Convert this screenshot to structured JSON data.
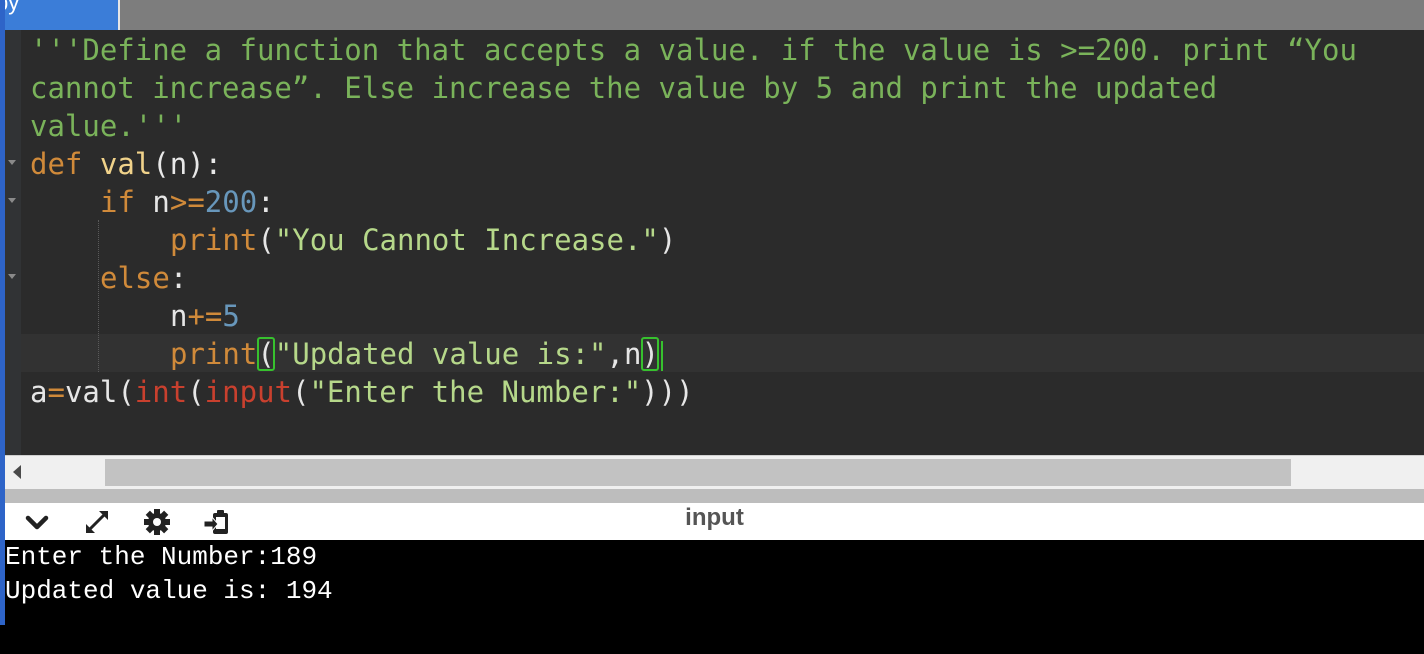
{
  "tab": {
    "label": "py"
  },
  "editor": {
    "docstring": [
      "'''Define a function that accepts a value. if the value is >=200. print “You",
      "cannot increase”. Else increase the value by 5 and print the updated",
      "value.'''"
    ],
    "code": {
      "kw_def": "def",
      "fn_val": "val",
      "paren_n": "(n):",
      "kw_if": "if",
      "var_n": "n",
      "op_ge": ">=",
      "num_200": "200",
      "colon": ":",
      "print_fn": "print",
      "paren_open": "(",
      "str_cannot": "\"You Cannot Increase.\"",
      "paren_close": ")",
      "kw_else": "else",
      "op_pluseq": "+=",
      "num_5": "5",
      "str_updated": "\"Updated value is:\"",
      "comma": ",",
      "var_a": "a",
      "op_eq": "=",
      "fn_int": "int",
      "fn_input": "input",
      "str_enter": "\"Enter the Number:\"",
      "close_parens": ")))"
    }
  },
  "console": {
    "title": "input",
    "lines": [
      "Enter the Number:189",
      "Updated value is: 194"
    ]
  },
  "icons": [
    "chevron-down-icon",
    "expand-icon",
    "gear-icon",
    "clipboard-icon"
  ],
  "colors": {
    "docstring": "#7ab35a",
    "keyword": "#d08a3a",
    "number": "#6897bb",
    "string": "#b6d88a",
    "builtin": "#c9402e",
    "bracket_match": "#37c12e",
    "editor_bg": "#2b2b2b",
    "console_bg": "#000000"
  }
}
